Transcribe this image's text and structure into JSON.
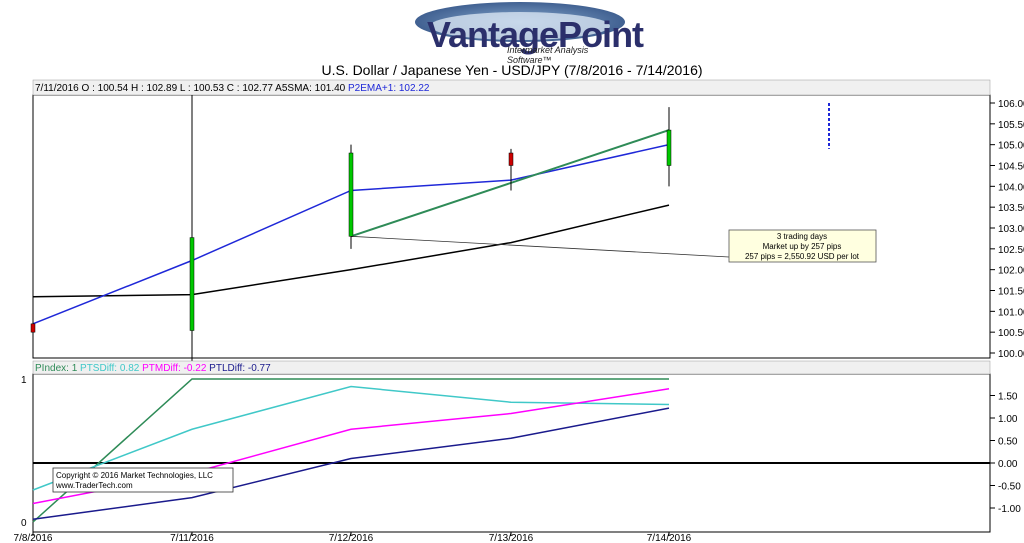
{
  "logo": {
    "name": "VantagePoint",
    "tagline": "Intermarket Analysis Software™"
  },
  "title": "U.S. Dollar / Japanese Yen -  USD/JPY     (7/8/2016 - 7/14/2016)",
  "upper_header": {
    "ohlc": "7/11/2016 O : 100.54  H : 102.89  L : 100.53  C : 102.77  A5SMA: 101.40",
    "ema": "P2EMA+1: 102.22"
  },
  "lower_header": [
    {
      "text": "PIndex: 1",
      "color": "#2e8b57"
    },
    {
      "text": "PTSDiff: 0.82",
      "color": "#40c8c8"
    },
    {
      "text": "PTMDiff: -0.22",
      "color": "#ff00ff"
    },
    {
      "text": "PTLDiff: -0.77",
      "color": "#1a1a8c"
    }
  ],
  "annotation": [
    "3 trading days",
    "Market up by 257 pips",
    "257 pips = 2,550.92 USD per lot"
  ],
  "copyright": [
    "Copyright © 2016 Market Technologies, LLC",
    "www.TraderTech.com"
  ],
  "colors": {
    "up": "#00c800",
    "down": "#cc0000",
    "ema": "#1f28d8",
    "sma": "#000000",
    "pindex": "#2e8b57",
    "pts": "#40c8c8",
    "ptm": "#ff00ff",
    "ptl": "#1a1a8c",
    "anno_bg": "#ffffe0"
  },
  "chart_data": [
    {
      "type": "candlestick",
      "title": "U.S. Dollar / Japanese Yen -  USD/JPY     (7/8/2016 - 7/14/2016)",
      "categories": [
        "7/8/2016",
        "7/11/2016",
        "7/12/2016",
        "7/13/2016",
        "7/14/2016"
      ],
      "ylim": [
        100.0,
        106.0
      ],
      "yticks": [
        "106.00",
        "105.50",
        "105.00",
        "104.50",
        "104.00",
        "103.50",
        "103.00",
        "102.50",
        "102.00",
        "101.50",
        "101.00",
        "100.50",
        "100.00"
      ],
      "candles": [
        {
          "date": "7/8/2016",
          "open": 100.7,
          "high": 100.9,
          "low": 100.5,
          "close": 100.5
        },
        {
          "date": "7/11/2016",
          "open": 100.54,
          "high": 102.89,
          "low": 100.53,
          "close": 102.77
        },
        {
          "date": "7/12/2016",
          "open": 102.8,
          "high": 105.0,
          "low": 102.5,
          "close": 104.8
        },
        {
          "date": "7/13/2016",
          "open": 104.8,
          "high": 104.9,
          "low": 103.9,
          "close": 104.5
        },
        {
          "date": "7/14/2016",
          "open": 104.5,
          "high": 105.9,
          "low": 104.0,
          "close": 105.35
        }
      ],
      "series": [
        {
          "name": "A5SMA",
          "values": [
            101.35,
            101.4,
            102.0,
            102.65,
            103.55
          ]
        },
        {
          "name": "P2EMA+1",
          "values": [
            100.7,
            102.22,
            103.9,
            104.15,
            105.0
          ]
        }
      ],
      "forecast_bar": {
        "position": 6,
        "high": 106.0,
        "low": 104.9
      },
      "trend_line": {
        "from": {
          "index": 2,
          "value": 102.8
        },
        "to": {
          "index": 4,
          "value": 105.35
        }
      },
      "annotation_line": {
        "from": {
          "index": 2,
          "value": 102.8
        }
      }
    },
    {
      "type": "line",
      "categories": [
        "7/8/2016",
        "7/11/2016",
        "7/12/2016",
        "7/13/2016",
        "7/14/2016"
      ],
      "ylim": [
        -1.2,
        1.7
      ],
      "yticks": [
        "1.50",
        "1.00",
        "0.50",
        "0.00",
        "-0.50",
        "-1.00"
      ],
      "left_ticks": [
        "1",
        "0"
      ],
      "series": [
        {
          "name": "PIndex",
          "values": [
            0,
            1,
            1,
            1,
            1
          ],
          "axis": "left"
        },
        {
          "name": "PTSDiff",
          "values": [
            -0.6,
            0.75,
            1.7,
            1.35,
            1.3
          ]
        },
        {
          "name": "PTMDiff",
          "values": [
            -0.9,
            -0.22,
            0.75,
            1.1,
            1.65
          ]
        },
        {
          "name": "PTLDiff",
          "values": [
            -1.25,
            -0.77,
            0.1,
            0.55,
            1.22
          ]
        }
      ]
    }
  ]
}
